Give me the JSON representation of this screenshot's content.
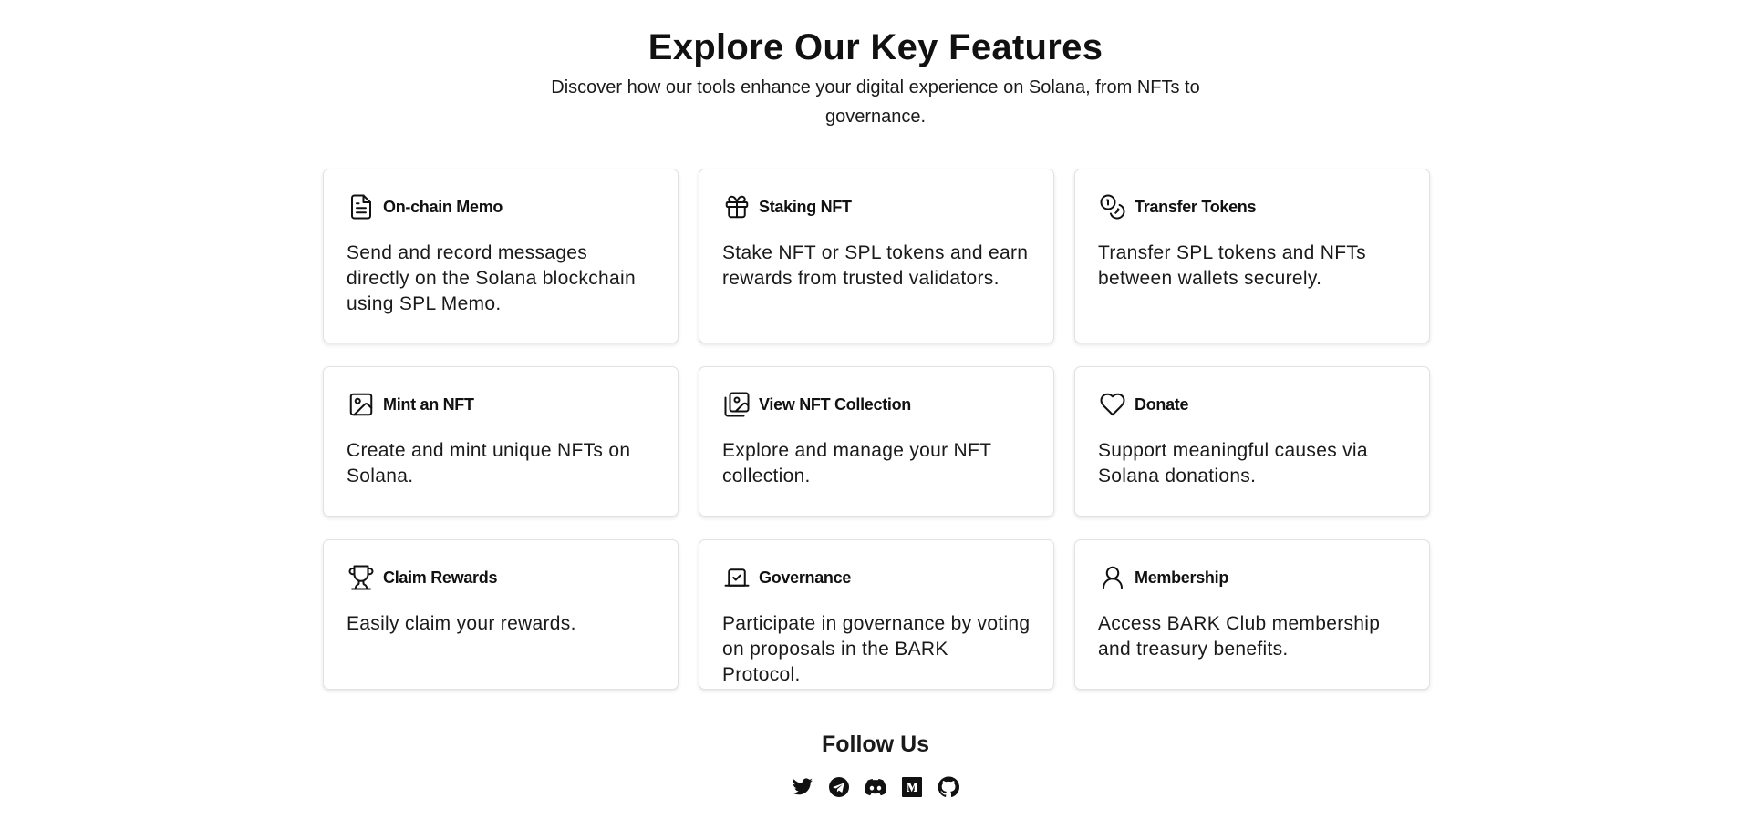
{
  "hero": {
    "title": "Explore Our Key Features",
    "subtitle": "Discover how our tools enhance your digital experience on Solana, from NFTs to governance."
  },
  "features": [
    {
      "icon": "document-icon",
      "title": "On-chain Memo",
      "description": "Send and record messages directly on the Solana blockchain using SPL Memo."
    },
    {
      "icon": "gift-icon",
      "title": "Staking NFT",
      "description": "Stake NFT or SPL tokens and earn rewards from trusted validators."
    },
    {
      "icon": "coins-icon",
      "title": "Transfer Tokens",
      "description": "Transfer SPL tokens and NFTs between wallets securely."
    },
    {
      "icon": "image-icon",
      "title": "Mint an NFT",
      "description": "Create and mint unique NFTs on Solana."
    },
    {
      "icon": "images-icon",
      "title": "View NFT Collection",
      "description": "Explore and manage your NFT collection."
    },
    {
      "icon": "heart-icon",
      "title": "Donate",
      "description": "Support meaningful causes via Solana donations."
    },
    {
      "icon": "trophy-icon",
      "title": "Claim Rewards",
      "description": "Easily claim your rewards."
    },
    {
      "icon": "vote-icon",
      "title": "Governance",
      "description": "Participate in governance by voting on proposals in the BARK Protocol."
    },
    {
      "icon": "user-icon",
      "title": "Membership",
      "description": "Access BARK Club membership and treasury benefits."
    }
  ],
  "follow": {
    "title": "Follow Us",
    "socials": [
      "twitter-icon",
      "telegram-icon",
      "discord-icon",
      "medium-icon",
      "github-icon"
    ]
  },
  "colors": {
    "text": "#111111",
    "card_border": "#e2e2e2",
    "background": "#ffffff"
  }
}
